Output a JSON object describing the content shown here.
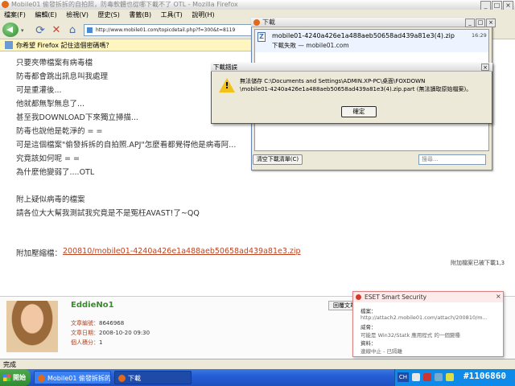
{
  "window": {
    "title": "Mobile01 偷發拆拆的自拍照，防毒軟體也從哪下載不了 OTL - Mozilla Firefox",
    "controls": [
      "_",
      "□",
      "×"
    ]
  },
  "menu": [
    "檔案(F)",
    "編輯(E)",
    "檢視(V)",
    "歷史(S)",
    "書籤(B)",
    "工具(T)",
    "說明(H)"
  ],
  "nav": {
    "url": "http://www.mobile01.com/topicdetail.php?f=300&t=8119"
  },
  "infobar": {
    "text": "你希望 Firefox 記住這個密碼嗎？"
  },
  "post": {
    "lines": [
      "只要夾帶檔案有病毒檔",
      "防毒都會跳出訊息叫我處理",
      "可是重灌後...",
      "他就都無掣無息了...",
      "甚至我DOWNLOAD下來獨立掃描...",
      "防毒也說他是乾淨的 = =",
      "可是這個檔案\"偷發拆拆的自拍照.APJ\"怎麼看都覺得他是病毒阿...",
      "究竟該如何呢 = =",
      "為什麼他變弱了....OTL",
      "",
      "附上疑似病毒的檔案",
      "請各位大大幫我測試我究竟是不是冤枉AVAST!了~QQ"
    ],
    "attach_label": "附加壓縮檔：",
    "attach_link": "200810/mobile01-4240a426e1a488aeb50658ad439a81e3.zip",
    "attach_note": "附加檔案已被下載1,3"
  },
  "author": {
    "name": "EddieNo1",
    "posts_label": "文章編號：",
    "posts": "8646968",
    "time_label": "文章日期：",
    "time": "2008-10-20 09:30",
    "score_label": "個人積分：",
    "score": "1",
    "quote_button": "回覆文章"
  },
  "status": {
    "text": "完成"
  },
  "downloads": {
    "title": "下載",
    "filename": "mobile01-4240a426e1a488aeb50658ad439a81e3(4).zip",
    "time": "16:29",
    "status": "下載失敗 — mobile01.com",
    "clear_button": "清空下載清單(C)",
    "search_placeholder": "搜尋..."
  },
  "error_dialog": {
    "title": "下載錯誤",
    "line1": "無法儲存 C:\\Documents and Settings\\ADMIN.XP-PC\\桌面\\FOXDOWN",
    "line2": "\\mobile01-4240a426e1a488aeb50658ad439a81e3(4).zip.part (無法讀取原始檔案)。",
    "ok_button": "確定"
  },
  "eset": {
    "title": "ESET Smart Security",
    "label_object": "檔案：",
    "value_object": "http://attach2.mobile01.com/attach/200810/m...",
    "label_threat": "威脅：",
    "value_threat": "可能是 Win32/Statk 應用程式 的一個變種",
    "label_info": "資料：",
    "value_info": "連線中止 - 已隔離"
  },
  "taskbar": {
    "start": "開始",
    "tasks": [
      "Mobile01 偷發拆拆的自...",
      "下載"
    ],
    "lang": "CH",
    "watermark": "#1106860"
  },
  "colors": {
    "link": "#bb4422",
    "author": "#3a8a2e",
    "taskbar": "#245ed8"
  }
}
